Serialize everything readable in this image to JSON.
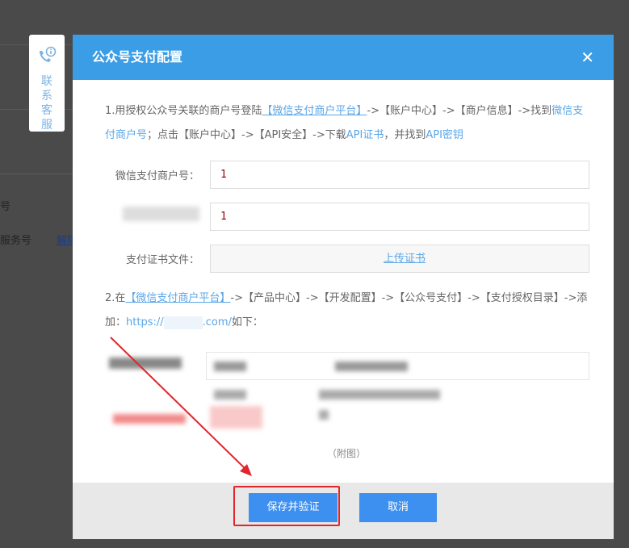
{
  "background": {
    "text1": "号",
    "text2": "服务号",
    "link": "解除"
  },
  "side": {
    "label": "联系客服"
  },
  "modal": {
    "title": "公众号支付配置",
    "step1": {
      "p1": "1.用授权公众号关联的商户号登陆",
      "link1": "【微信支付商户平台】",
      "p2": "->【账户中心】->【商户信息】->找到",
      "link2": "微信支付商户号",
      "p3": "；点击【账户中心】->【API安全】->下载",
      "link3": "API证书",
      "p4": "，并找到",
      "link4": "API密钥"
    },
    "fields": [
      {
        "label": "微信支付商户号：",
        "value": "1"
      },
      {
        "label": "",
        "value": "1"
      },
      {
        "label": "支付证书文件：",
        "upload": "上传证书"
      }
    ],
    "step2": {
      "p1": "2.在",
      "link1": "【微信支付商户平台】",
      "p2": "->【产品中心】->【开发配置】->【公众号支付】->【支付授权目录】->添加：",
      "link2a": "https://",
      "link2b": ".com/",
      "p3": "如下："
    },
    "caption": "（附图）",
    "save": "保存并验证",
    "cancel": "取消"
  },
  "colors": {
    "accent": "#3a9de6",
    "button": "#3d8ff0",
    "annotation": "#e0262c"
  }
}
